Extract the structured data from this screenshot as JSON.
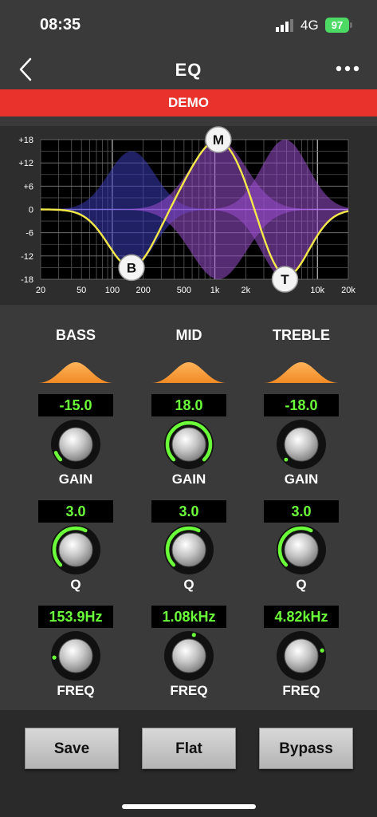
{
  "status": {
    "time": "08:35",
    "network": "4G",
    "battery": "97"
  },
  "header": {
    "title": "EQ"
  },
  "banner": {
    "text": "DEMO"
  },
  "graph": {
    "y_ticks": [
      "+18",
      "+12",
      "+6",
      "0",
      "-6",
      "-12",
      "-18"
    ],
    "x_ticks": [
      "20",
      "50",
      "100",
      "200",
      "500",
      "1k",
      "2k",
      "10k",
      "20k"
    ],
    "x_tick_values": [
      20,
      50,
      100,
      200,
      500,
      1000,
      2000,
      10000,
      20000
    ],
    "nodes": [
      {
        "label": "B",
        "freq": 153.9,
        "gain": -15.0
      },
      {
        "label": "M",
        "freq": 1080,
        "gain": 18.0
      },
      {
        "label": "T",
        "freq": 4820,
        "gain": -18.0
      }
    ],
    "colors": {
      "curve": "#f5e94a",
      "fill_low": "#3a3ab8",
      "fill_high": "#9a4fd0",
      "grid": "#8a8a8a"
    }
  },
  "bands": [
    {
      "name": "BASS",
      "gain": "-15.0",
      "gain_label": "GAIN",
      "q": "3.0",
      "q_label": "Q",
      "freq": "153.9Hz",
      "freq_label": "FREQ",
      "gain_level": 0.083,
      "q_level": 0.6,
      "freq_level": 0.15
    },
    {
      "name": "MID",
      "gain": "18.0",
      "gain_label": "GAIN",
      "q": "3.0",
      "q_label": "Q",
      "freq": "1.08kHz",
      "freq_label": "FREQ",
      "gain_level": 1.0,
      "q_level": 0.6,
      "freq_level": 0.55
    },
    {
      "name": "TREBLE",
      "gain": "-18.0",
      "gain_label": "GAIN",
      "q": "3.0",
      "q_label": "Q",
      "freq": "4.82kHz",
      "freq_label": "FREQ",
      "gain_level": 0.0,
      "q_level": 0.6,
      "freq_level": 0.78
    }
  ],
  "buttons": {
    "save": "Save",
    "flat": "Flat",
    "bypass": "Bypass"
  },
  "accent": {
    "value_text": "#6bff3a",
    "arc": "#6bff3a",
    "band_shape": "#f08a24"
  }
}
